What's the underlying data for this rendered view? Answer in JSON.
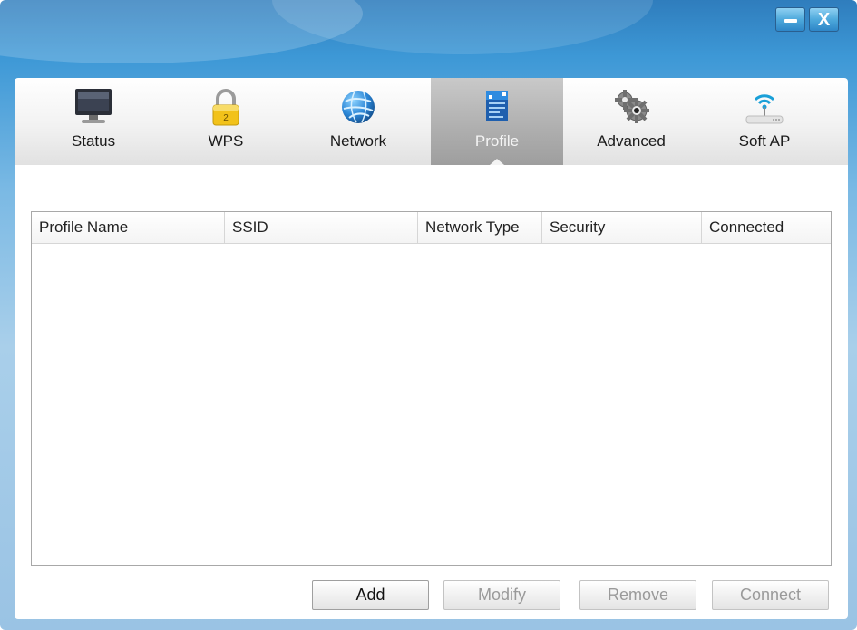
{
  "window": {
    "minimize_icon": "minimize-icon",
    "close_icon": "close-icon",
    "close_glyph": "X"
  },
  "tabs": [
    {
      "label": "Status",
      "icon": "monitor-icon",
      "active": false
    },
    {
      "label": "WPS",
      "icon": "padlock-icon",
      "active": false
    },
    {
      "label": "Network",
      "icon": "globe-icon",
      "active": false
    },
    {
      "label": "Profile",
      "icon": "profile-document-icon",
      "active": true
    },
    {
      "label": "Advanced",
      "icon": "gears-icon",
      "active": false
    },
    {
      "label": "Soft AP",
      "icon": "wireless-router-icon",
      "active": false
    }
  ],
  "table": {
    "columns": [
      "Profile Name",
      "SSID",
      "Network Type",
      "Security",
      "Connected"
    ],
    "rows": []
  },
  "buttons": {
    "add": {
      "label": "Add",
      "enabled": true
    },
    "modify": {
      "label": "Modify",
      "enabled": false
    },
    "remove": {
      "label": "Remove",
      "enabled": false
    },
    "connect": {
      "label": "Connect",
      "enabled": false
    }
  },
  "colors": {
    "titlebar_blue": "#3d98d6",
    "active_tab": "#aeaeae"
  }
}
